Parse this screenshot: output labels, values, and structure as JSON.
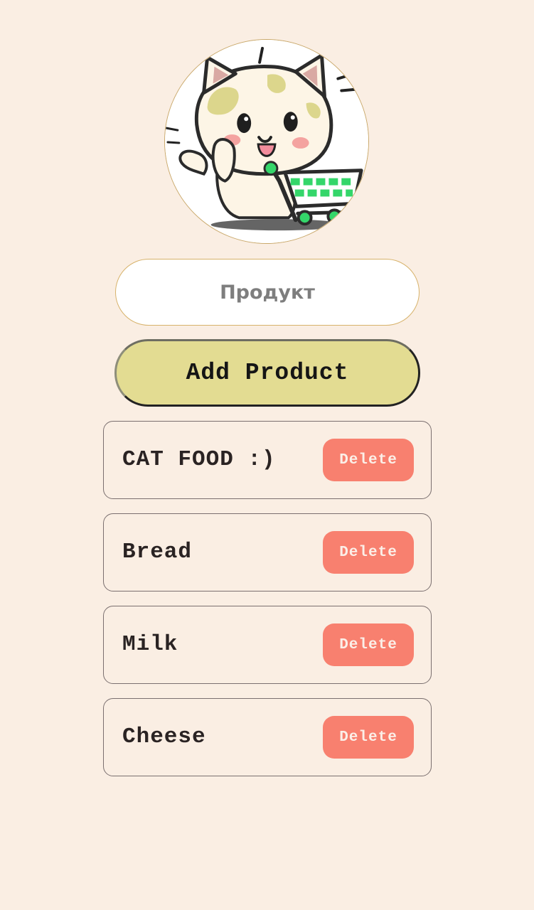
{
  "header": {
    "avatar_icon": "cat-with-shopping-cart-icon"
  },
  "form": {
    "input_value": "",
    "input_placeholder": "Продукт",
    "add_label": "Add Product"
  },
  "items": [
    {
      "name": "CAT FOOD :)",
      "delete_label": "Delete"
    },
    {
      "name": "Bread",
      "delete_label": "Delete"
    },
    {
      "name": "Milk",
      "delete_label": "Delete"
    },
    {
      "name": "Cheese",
      "delete_label": "Delete"
    }
  ],
  "colors": {
    "background": "#FAEEE3",
    "add_button": "#E3DC92",
    "delete_button": "#F8806F",
    "cart_accent": "#34D66A"
  }
}
